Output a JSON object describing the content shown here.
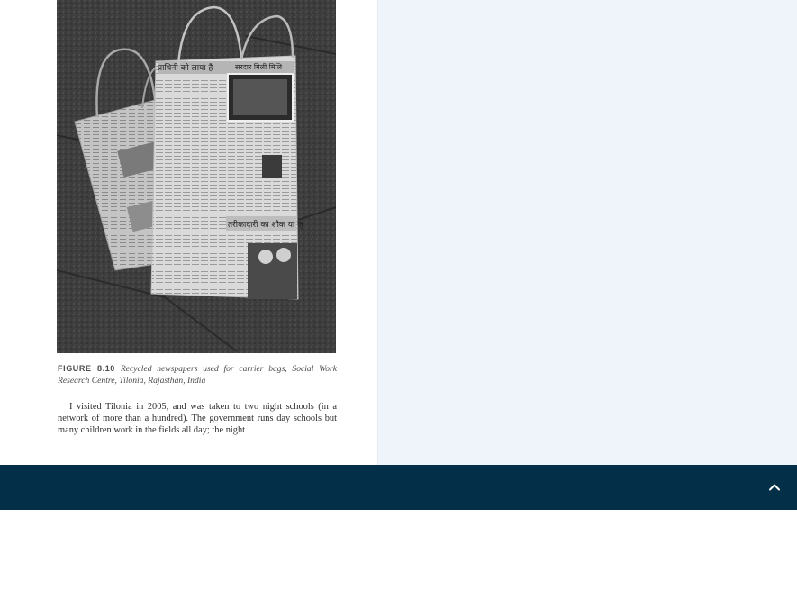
{
  "document": {
    "figure": {
      "label": "FIGURE 8.10",
      "caption": "Recycled newspapers used for carrier bags, Social Work Research Centre, Tilonia, Rajasthan, India",
      "newspaper_headlines": [
        "प्राधिनी को लाया है",
        "सरदार मिली मिलि",
        "तरीकादारी का शौक या ज़ु"
      ]
    },
    "paragraph": "I visited Tilonia in 2005, and was taken to two night schools (in a network of more than a hundred). The government runs day schools but many children work in the fields all day; the night"
  },
  "colors": {
    "side_panel": "#eff3fa",
    "bottom_bar": "#033048",
    "caption_text": "#4a4a4a"
  },
  "bottom_bar": {
    "scroll_top_icon": "chevron-up-icon"
  }
}
